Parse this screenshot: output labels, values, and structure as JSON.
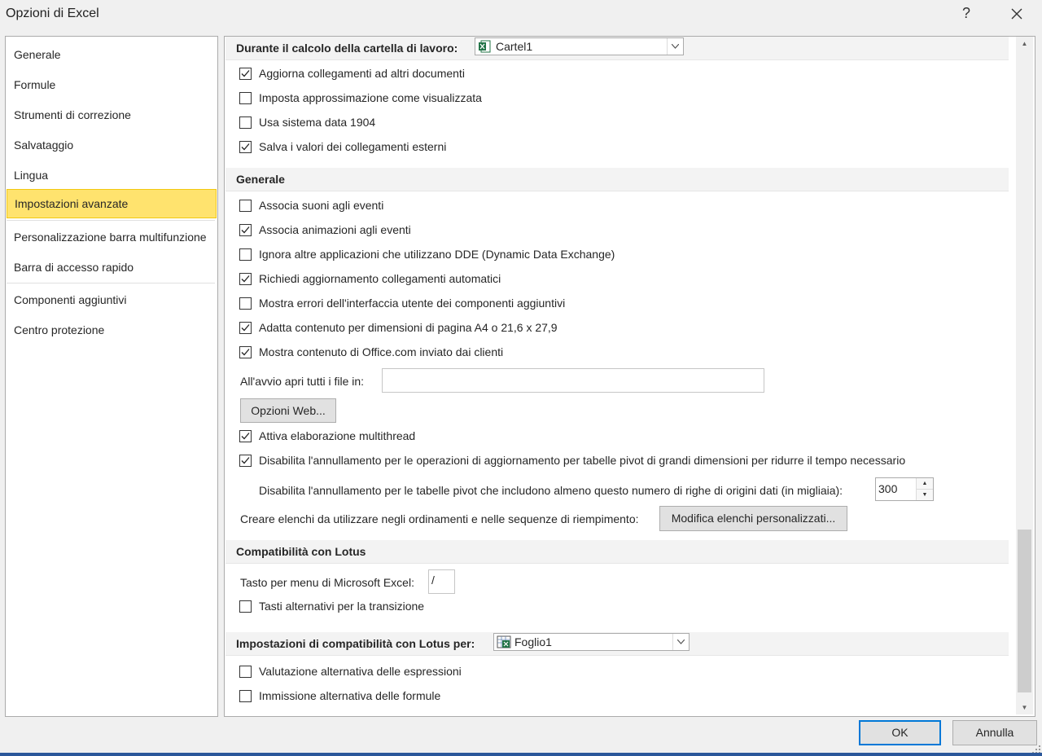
{
  "window": {
    "title": "Opzioni di Excel",
    "help": "?",
    "close_icon": "close-icon"
  },
  "nav": {
    "items": [
      {
        "label": "Generale"
      },
      {
        "label": "Formule"
      },
      {
        "label": "Strumenti di correzione"
      },
      {
        "label": "Salvataggio"
      },
      {
        "label": "Lingua"
      },
      {
        "label": "Impostazioni avanzate",
        "selected": true
      },
      {
        "label": "Personalizzazione barra multifunzione"
      },
      {
        "label": "Barra di accesso rapido"
      },
      {
        "label": "Componenti aggiuntivi"
      },
      {
        "label": "Centro protezione"
      }
    ]
  },
  "calc_section": {
    "title": "Durante il calcolo della cartella di lavoro:",
    "workbook": "Cartel1",
    "options": [
      {
        "label": "Aggiorna collegamenti ad altri documenti",
        "checked": true
      },
      {
        "label": "Imposta approssimazione come visualizzata",
        "checked": false
      },
      {
        "label": "Usa sistema data 1904",
        "checked": false
      },
      {
        "label": "Salva i valori dei collegamenti esterni",
        "checked": true
      }
    ]
  },
  "general_section": {
    "title": "Generale",
    "options": [
      {
        "label": "Associa suoni agli eventi",
        "checked": false
      },
      {
        "label": "Associa animazioni agli eventi",
        "checked": true
      },
      {
        "label": "Ignora altre applicazioni che utilizzano DDE (Dynamic Data Exchange)",
        "checked": false
      },
      {
        "label": "Richiedi aggiornamento collegamenti automatici",
        "checked": true
      },
      {
        "label": "Mostra errori dell'interfaccia utente dei componenti aggiuntivi",
        "checked": false
      },
      {
        "label": "Adatta contenuto per dimensioni di pagina A4 o 21,6 x 27,9",
        "checked": true
      },
      {
        "label": "Mostra contenuto di Office.com inviato dai clienti",
        "checked": true
      }
    ],
    "startup_label": "All'avvio apri tutti i file in:",
    "startup_value": "",
    "web_options_button": "Opzioni Web...",
    "multithread": {
      "label": "Attiva elaborazione multithread",
      "checked": true
    },
    "pivot_undo": {
      "label": "Disabilita l'annullamento per le operazioni di aggiornamento per tabelle pivot di grandi dimensioni per ridurre il tempo necessario",
      "checked": true
    },
    "pivot_rows_label": "Disabilita l'annullamento per le tabelle pivot che includono almeno questo numero di righe di origini dati (in migliaia):",
    "pivot_rows_value": "300",
    "lists_label": "Creare elenchi da utilizzare negli ordinamenti e nelle sequenze di riempimento:",
    "lists_button": "Modifica elenchi personalizzati..."
  },
  "lotus_section": {
    "title": "Compatibilità con Lotus",
    "menu_key_label": "Tasto per menu di Microsoft Excel:",
    "menu_key_value": "/",
    "alt_nav": {
      "label": "Tasti alternativi per la transizione",
      "checked": false
    }
  },
  "lotus_settings_section": {
    "title": "Impostazioni di compatibilità con Lotus per:",
    "sheet": "Foglio1",
    "options": [
      {
        "label": "Valutazione alternativa delle espressioni",
        "checked": false
      },
      {
        "label": "Immissione alternativa delle formule",
        "checked": false
      }
    ]
  },
  "footer": {
    "ok": "OK",
    "cancel": "Annulla"
  },
  "colors": {
    "selected_bg": "#ffe36e",
    "accent": "#0078d7",
    "section_bg": "#f3f3f3"
  }
}
